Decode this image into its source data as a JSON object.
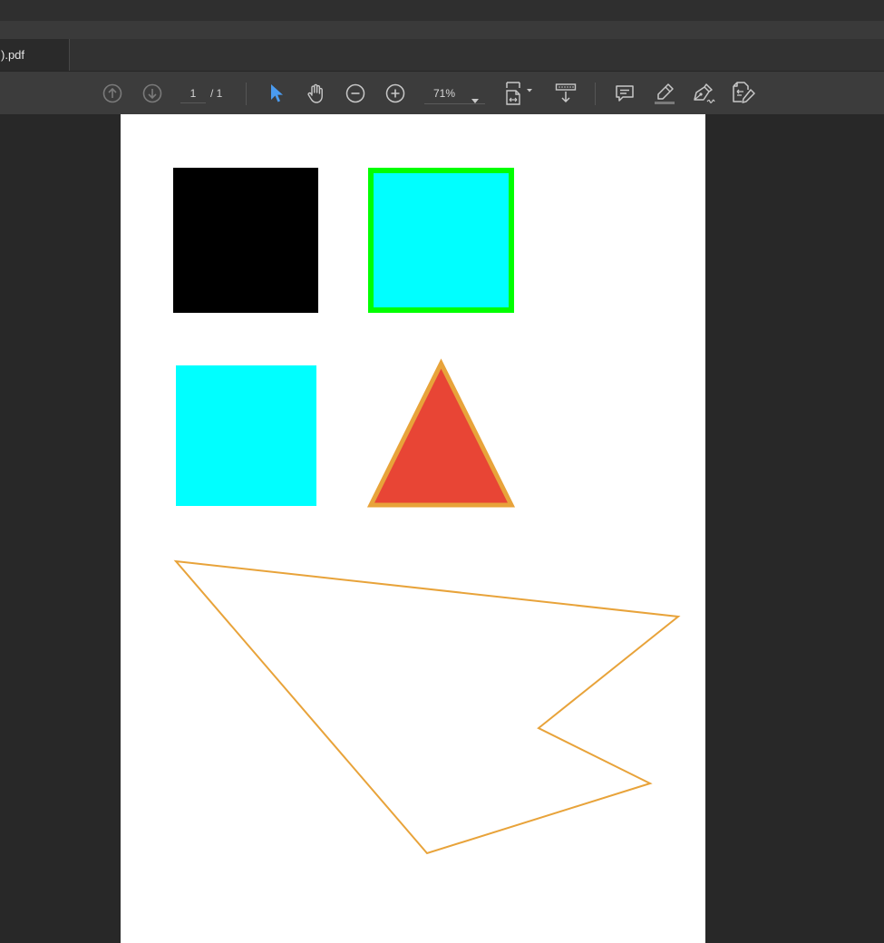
{
  "tab": {
    "filename": ").pdf"
  },
  "toolbar": {
    "prev_page_icon": "arrow-up-circle-icon",
    "next_page_icon": "arrow-down-circle-icon",
    "current_page": "1",
    "total_pages": "/ 1",
    "select_tool_icon": "cursor-arrow-icon",
    "hand_tool_icon": "hand-icon",
    "zoom_out_icon": "minus-circle-icon",
    "zoom_in_icon": "plus-circle-icon",
    "zoom_value": "71%",
    "fit_icon": "fit-page-icon",
    "scroll_mode_icon": "scroll-mode-icon",
    "comment_icon": "comment-icon",
    "highlight_icon": "highlighter-icon",
    "sign_icon": "pen-sign-icon",
    "edit_icon": "edit-pdf-icon"
  },
  "colors": {
    "active_tool": "#4a9bf0",
    "icon": "#c8c8c8",
    "icon_disabled": "#7a7a7a",
    "black_square": "#000000",
    "cyan": "#00ffff",
    "green_border": "#00ff00",
    "triangle_fill": "#e84535",
    "orange_stroke": "#e8a33a"
  },
  "page_shapes": [
    {
      "name": "black-square",
      "shape": "rect",
      "fill": "#000000"
    },
    {
      "name": "cyan-square-green-border",
      "shape": "rect",
      "fill": "#00ffff",
      "stroke": "#00ff00"
    },
    {
      "name": "cyan-square",
      "shape": "rect",
      "fill": "#00ffff"
    },
    {
      "name": "red-triangle",
      "shape": "triangle",
      "fill": "#e84535",
      "stroke": "#e8a33a"
    },
    {
      "name": "orange-outline-polygon",
      "shape": "polygon",
      "fill": "none",
      "stroke": "#e8a33a"
    }
  ]
}
